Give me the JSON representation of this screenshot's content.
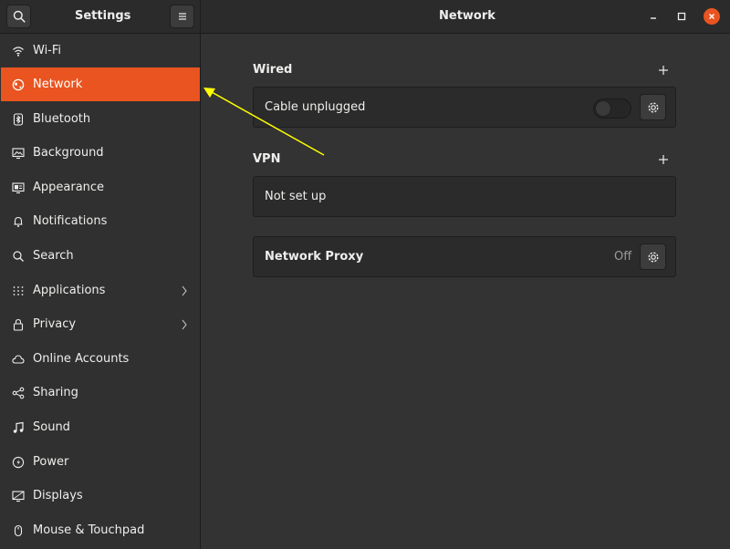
{
  "sidebar_header": {
    "title": "Settings"
  },
  "window": {
    "title": "Network"
  },
  "sidebar": {
    "items": [
      {
        "label": "Wi-Fi",
        "icon": "wifi-icon"
      },
      {
        "label": "Network",
        "icon": "network-icon",
        "active": true
      },
      {
        "label": "Bluetooth",
        "icon": "bluetooth-icon"
      },
      {
        "label": "Background",
        "icon": "background-icon"
      },
      {
        "label": "Appearance",
        "icon": "appearance-icon"
      },
      {
        "label": "Notifications",
        "icon": "bell-icon"
      },
      {
        "label": "Search",
        "icon": "search-icon"
      },
      {
        "label": "Applications",
        "icon": "grid-icon",
        "has_submenu": true
      },
      {
        "label": "Privacy",
        "icon": "lock-icon",
        "has_submenu": true
      },
      {
        "label": "Online Accounts",
        "icon": "cloud-icon"
      },
      {
        "label": "Sharing",
        "icon": "share-icon"
      },
      {
        "label": "Sound",
        "icon": "music-note-icon"
      },
      {
        "label": "Power",
        "icon": "power-icon"
      },
      {
        "label": "Displays",
        "icon": "display-icon"
      },
      {
        "label": "Mouse & Touchpad",
        "icon": "mouse-icon"
      }
    ]
  },
  "main": {
    "wired": {
      "title": "Wired",
      "connection_label": "Cable unplugged",
      "toggle_on": false
    },
    "vpn": {
      "title": "VPN",
      "status": "Not set up"
    },
    "proxy": {
      "label": "Network Proxy",
      "status": "Off"
    }
  },
  "colors": {
    "accent": "#e95420",
    "annotation_arrow": "#ffff00"
  }
}
